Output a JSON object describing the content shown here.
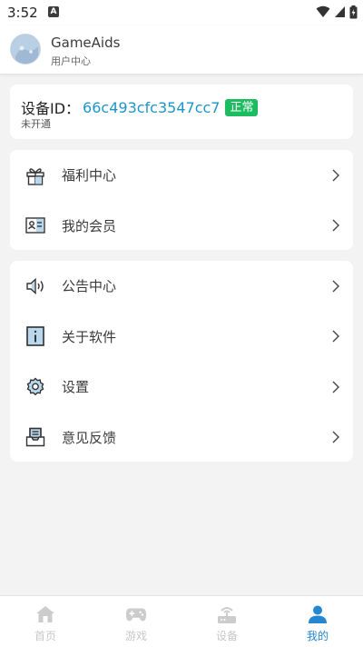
{
  "status_bar": {
    "time": "3:52",
    "notification_glyph": "A"
  },
  "header": {
    "app_name": "GameAids",
    "subtitle": "用户中心"
  },
  "device": {
    "label": "设备ID：",
    "id": "66c493cfc3547cc7",
    "status_badge": "正常",
    "status_text": "未开通",
    "badge_color": "#1ebc61",
    "id_color": "#1c95c9"
  },
  "menu_group_1": [
    {
      "label": "福利中心",
      "icon": "gift-icon"
    },
    {
      "label": "我的会员",
      "icon": "member-card-icon"
    }
  ],
  "menu_group_2": [
    {
      "label": "公告中心",
      "icon": "speaker-icon"
    },
    {
      "label": "关于软件",
      "icon": "info-icon"
    },
    {
      "label": "设置",
      "icon": "gear-icon"
    },
    {
      "label": "意见反馈",
      "icon": "feedback-inbox-icon"
    }
  ],
  "tabs": [
    {
      "label": "首页",
      "icon": "home-icon",
      "active": false
    },
    {
      "label": "游戏",
      "icon": "gamepad-icon",
      "active": false
    },
    {
      "label": "设备",
      "icon": "device-router-icon",
      "active": false
    },
    {
      "label": "我的",
      "icon": "user-icon",
      "active": true
    }
  ],
  "colors": {
    "accent": "#2487cf",
    "inactive_tab": "#c8c8c8",
    "background": "#f3f3f3"
  }
}
